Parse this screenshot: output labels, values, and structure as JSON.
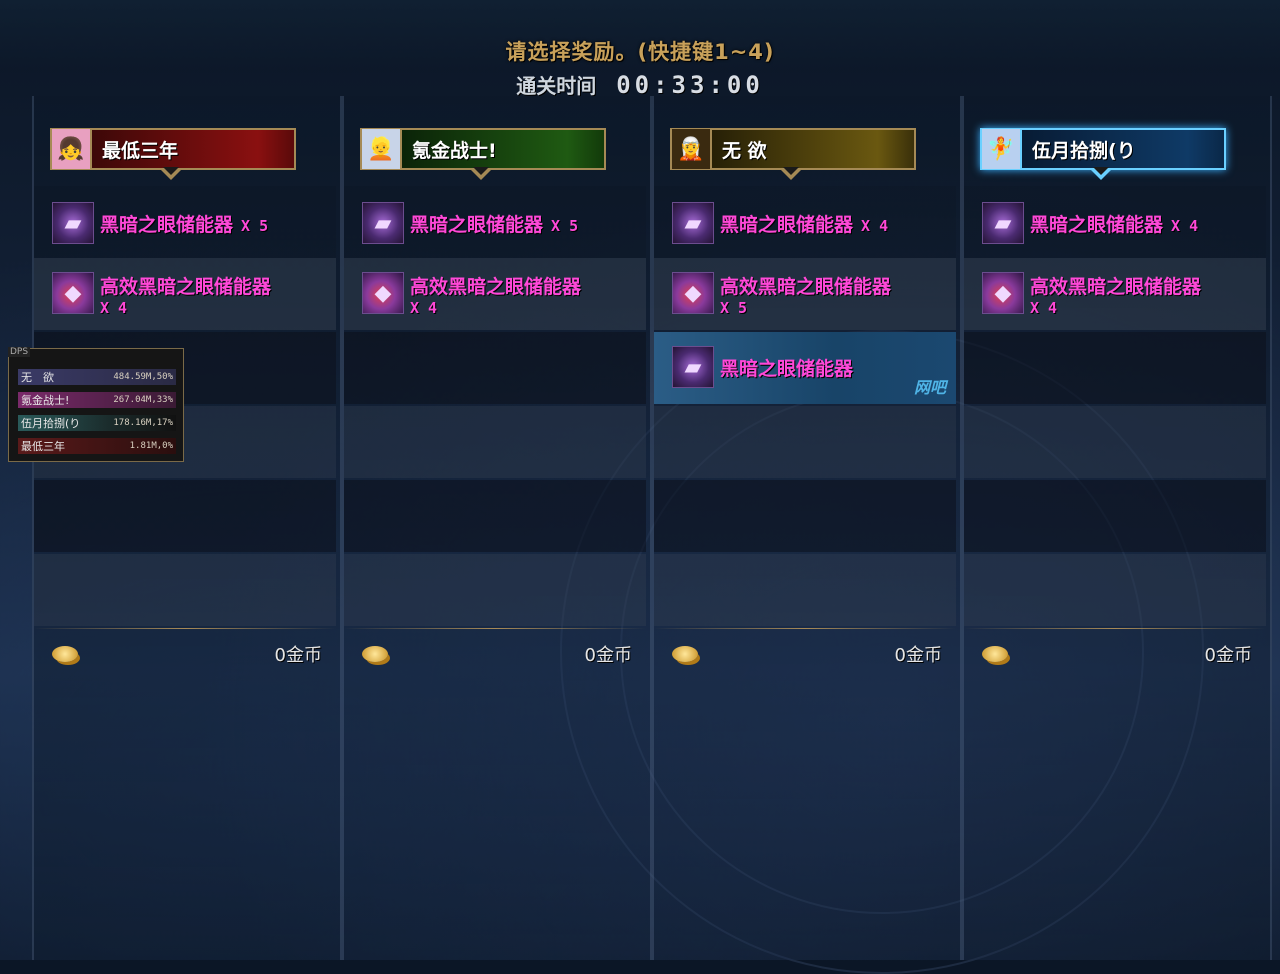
{
  "header": {
    "prompt": "请选择奖励。(快捷键1~4)",
    "time_label": "通关时间",
    "time_value": "00:33:00"
  },
  "players": [
    {
      "name": "最低三年",
      "bar_color": "#8a1010",
      "portrait_icon": "pink-hair-portrait",
      "rewards": [
        {
          "name": "黑暗之眼储能器",
          "qty": "X 5",
          "icon": "purple-vial-icon"
        },
        {
          "name": "高效黑暗之眼储能器",
          "qty": "X 4",
          "icon": "red-gem-vial-icon"
        }
      ],
      "gold": "0金币"
    },
    {
      "name": "氪金战士!",
      "bar_color": "#1f5a12",
      "portrait_icon": "white-hair-portrait",
      "rewards": [
        {
          "name": "黑暗之眼储能器",
          "qty": "X 5",
          "icon": "purple-vial-icon"
        },
        {
          "name": "高效黑暗之眼储能器",
          "qty": "X 4",
          "icon": "red-gem-vial-icon"
        }
      ],
      "gold": "0金币"
    },
    {
      "name": "无 欲",
      "bar_color": "#6a5810",
      "portrait_icon": "dark-blonde-portrait",
      "rewards": [
        {
          "name": "黑暗之眼储能器",
          "qty": "X 4",
          "icon": "purple-vial-icon"
        },
        {
          "name": "高效黑暗之眼储能器",
          "qty": "X 5",
          "icon": "red-gem-vial-icon"
        },
        {
          "name": "黑暗之眼储能器",
          "qty": "",
          "icon": "purple-vial-icon",
          "tag": "网吧"
        }
      ],
      "gold": "0金币"
    },
    {
      "name": "伍月拾捌(り",
      "bar_color": "#0f3a66",
      "portrait_icon": "blue-hair-portrait",
      "rewards": [
        {
          "name": "黑暗之眼储能器",
          "qty": "X 4",
          "icon": "purple-vial-icon"
        },
        {
          "name": "高效黑暗之眼储能器",
          "qty": "X 4",
          "icon": "red-gem-vial-icon"
        }
      ],
      "gold": "0金币"
    }
  ],
  "dps_meter": {
    "title": "DPS",
    "rows": [
      {
        "name": "无　欲",
        "value": "484.59M,50%",
        "color": "#3a3a66"
      },
      {
        "name": "氪金战士!",
        "value": "267.04M,33%",
        "color": "#6a2a5a"
      },
      {
        "name": "伍月拾捌(り",
        "value": "178.16M,17%",
        "color": "#2a5a5a"
      },
      {
        "name": "最低三年",
        "value": "1.81M,0%",
        "color": "#5a1a1a"
      }
    ]
  }
}
